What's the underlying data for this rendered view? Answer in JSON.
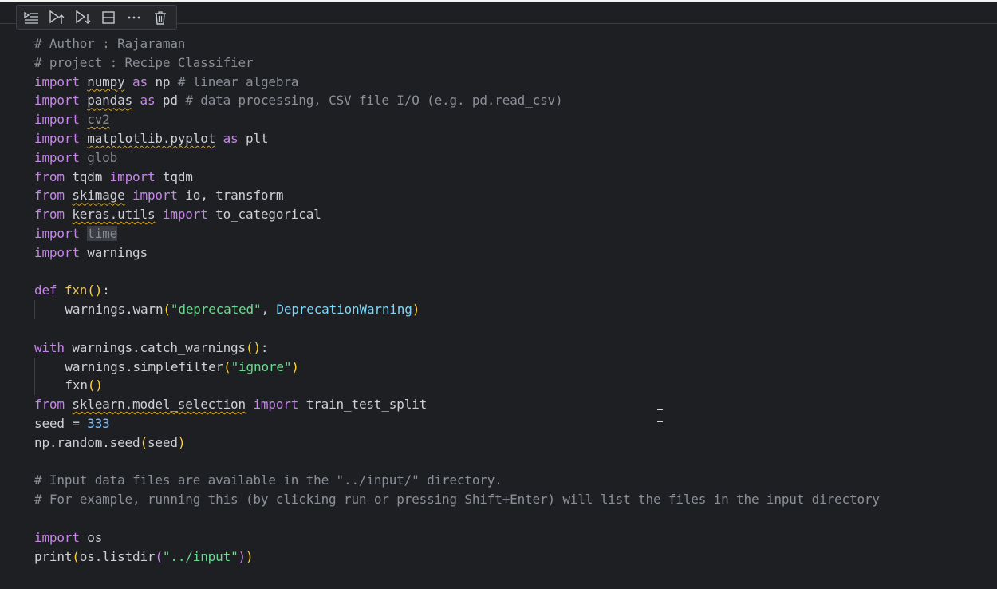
{
  "toolbar": {
    "buttons": [
      {
        "name": "run-by-line",
        "icon": "run-by-line-icon"
      },
      {
        "name": "execute-above",
        "icon": "execute-above-icon"
      },
      {
        "name": "execute-below",
        "icon": "execute-below-icon"
      },
      {
        "name": "split-cell",
        "icon": "split-cell-icon"
      },
      {
        "name": "more-actions",
        "icon": "more-icon"
      },
      {
        "name": "delete-cell",
        "icon": "trash-icon"
      }
    ]
  },
  "code": {
    "l1": "# Author : Rajaraman",
    "l2": "# project : Recipe Classifier",
    "l3": {
      "kw": "import",
      "mod": "numpy",
      "as": "as",
      "alias": "np",
      "comment": "# linear algebra"
    },
    "l4": {
      "kw": "import",
      "mod": "pandas",
      "as": "as",
      "alias": "pd",
      "comment": "# data processing, CSV file I/O (e.g. pd.read_csv)"
    },
    "l5": {
      "kw": "import",
      "mod": "cv2"
    },
    "l6": {
      "kw": "import",
      "mod": "matplotlib.pyplot",
      "as": "as",
      "alias": "plt"
    },
    "l7": {
      "kw": "import",
      "mod": "glob"
    },
    "l8": {
      "kw1": "from",
      "mod": "tqdm",
      "kw2": "import",
      "name": "tqdm"
    },
    "l9": {
      "kw1": "from",
      "mod": "skimage",
      "kw2": "import",
      "name": "io, transform"
    },
    "l10": {
      "kw1": "from",
      "mod": "keras.utils",
      "kw2": "import",
      "name": "to_categorical"
    },
    "l11": {
      "kw": "import",
      "mod": "time"
    },
    "l12": {
      "kw": "import",
      "mod": "warnings"
    },
    "l14": {
      "kw": "def",
      "fn": "fxn",
      "open": "():",
      "colon": ""
    },
    "l15": {
      "call": "warnings.warn",
      "str": "\"deprecated\"",
      "sep": ", ",
      "cls": "DeprecationWarning"
    },
    "l17": {
      "kw": "with",
      "call": "warnings.catch_warnings",
      "suffix": ":"
    },
    "l18": {
      "call": "warnings.simplefilter",
      "str": "\"ignore\""
    },
    "l19": {
      "call": "fxn"
    },
    "l20": {
      "kw1": "from",
      "mod": "sklearn.model_selection",
      "kw2": "import",
      "name": "train_test_split"
    },
    "l21": {
      "var": "seed = ",
      "num": "333"
    },
    "l22": {
      "call": "np.random.seed",
      "arg": "seed"
    },
    "l24": "# Input data files are available in the \"../input/\" directory.",
    "l25": "# For example, running this (by clicking run or pressing Shift+Enter) will list the files in the input directory",
    "l27": {
      "kw": "import",
      "mod": "os"
    },
    "l28": {
      "call": "print",
      "inner": "os.listdir",
      "str": "\"../input\""
    }
  },
  "colors": {
    "background": "#1e1f22",
    "keyword": "#c586e8",
    "comment": "#8a8f98",
    "string": "#6bd98f",
    "number": "#79c0ff",
    "function": "#e8c46a",
    "class": "#7fd6f7",
    "bracket": "#ffd22e",
    "warning_squiggle": "#d9a81a"
  }
}
